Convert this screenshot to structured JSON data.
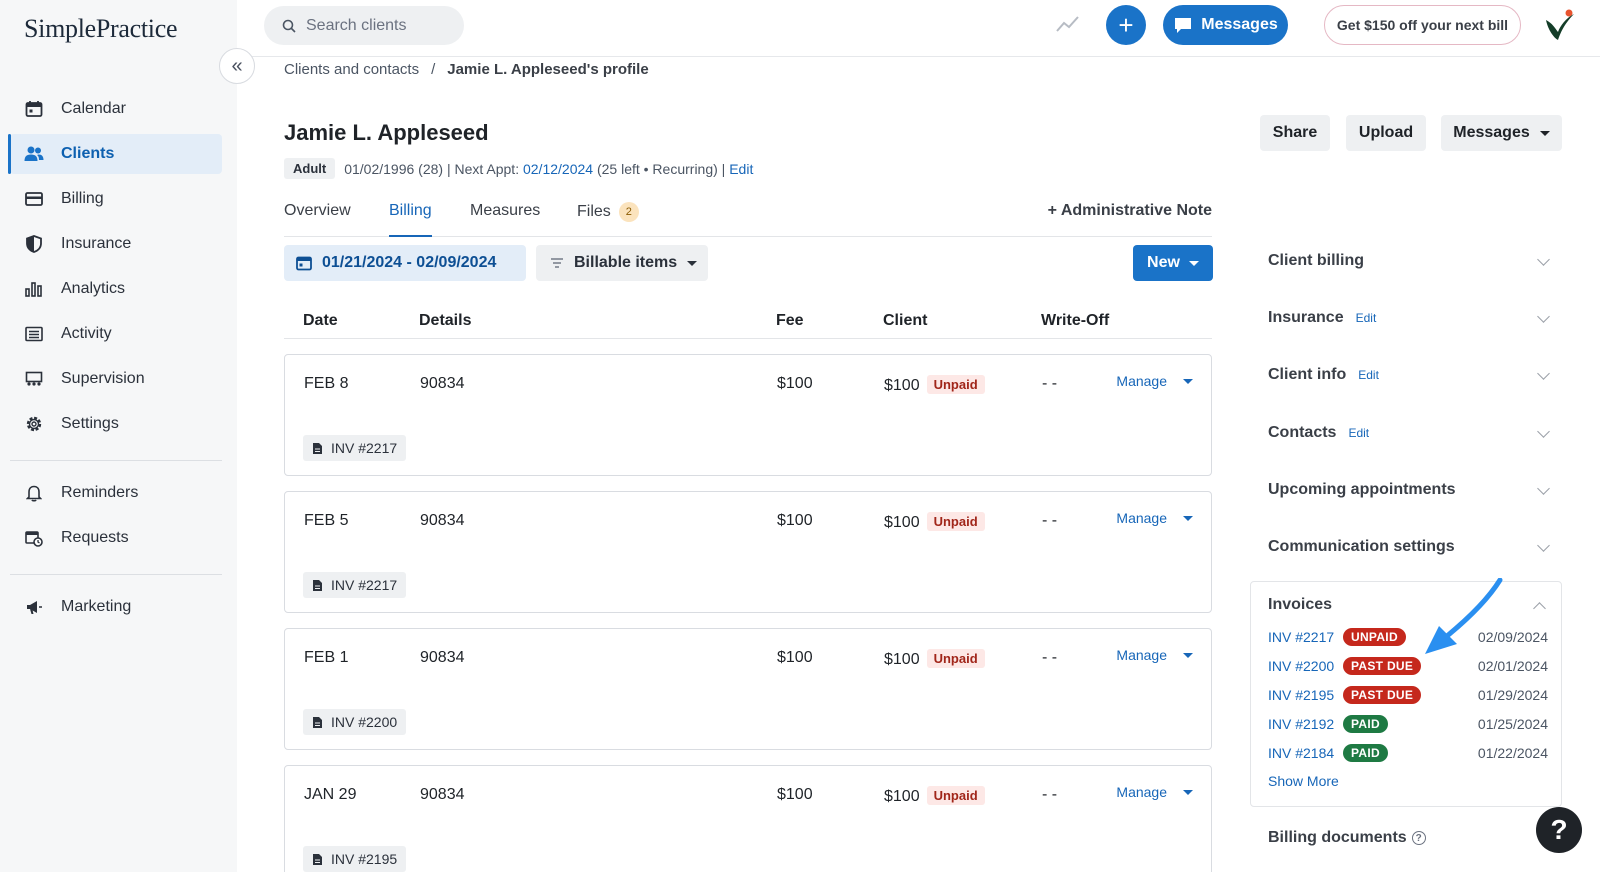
{
  "brand": {
    "logo_text": "SimplePractice"
  },
  "sidebar": {
    "items": [
      {
        "label": "Calendar",
        "icon": "calendar-icon"
      },
      {
        "label": "Clients",
        "icon": "users-icon",
        "active": true
      },
      {
        "label": "Billing",
        "icon": "credit-card-icon"
      },
      {
        "label": "Insurance",
        "icon": "shield-icon"
      },
      {
        "label": "Analytics",
        "icon": "bar-chart-icon"
      },
      {
        "label": "Activity",
        "icon": "list-icon"
      },
      {
        "label": "Supervision",
        "icon": "supervision-icon"
      },
      {
        "label": "Settings",
        "icon": "gear-icon"
      }
    ],
    "secondary": [
      {
        "label": "Reminders",
        "icon": "bell-icon"
      },
      {
        "label": "Requests",
        "icon": "calendar-clock-icon"
      }
    ],
    "tertiary": [
      {
        "label": "Marketing",
        "icon": "megaphone-icon"
      }
    ]
  },
  "topbar": {
    "search_placeholder": "Search clients",
    "messages_label": "Messages",
    "promo_label": "Get $150 off your next bill",
    "accent_color": "#1a73c8"
  },
  "breadcrumb": {
    "parent": "Clients and contacts",
    "separator": "/",
    "current": "Jamie L. Appleseed's profile"
  },
  "client": {
    "name": "Jamie L. Appleseed",
    "badge": "Adult",
    "dob": "01/02/1996 (28) | Next Appt:",
    "next_appt": "02/12/2024",
    "appt_detail": "(25 left • Recurring) |",
    "edit_label": "Edit"
  },
  "header_actions": {
    "share": "Share",
    "upload": "Upload",
    "messages": "Messages"
  },
  "tabs": {
    "overview": "Overview",
    "billing": "Billing",
    "measures": "Measures",
    "files": "Files",
    "files_count": "2",
    "admin_note": "+ Administrative Note"
  },
  "filters": {
    "date_range": "01/21/2024 - 02/09/2024",
    "billable": "Billable items",
    "new_label": "New"
  },
  "table": {
    "headers": {
      "date": "Date",
      "details": "Details",
      "fee": "Fee",
      "client": "Client",
      "writeoff": "Write-Off"
    },
    "rows": [
      {
        "date": "FEB 8",
        "details": "90834",
        "fee": "$100",
        "client": "$100",
        "status": "Unpaid",
        "writeoff": "- -",
        "manage": "Manage",
        "invoice": "INV #2217"
      },
      {
        "date": "FEB 5",
        "details": "90834",
        "fee": "$100",
        "client": "$100",
        "status": "Unpaid",
        "writeoff": "- -",
        "manage": "Manage",
        "invoice": "INV #2217"
      },
      {
        "date": "FEB 1",
        "details": "90834",
        "fee": "$100",
        "client": "$100",
        "status": "Unpaid",
        "writeoff": "- -",
        "manage": "Manage",
        "invoice": "INV #2200"
      },
      {
        "date": "JAN 29",
        "details": "90834",
        "fee": "$100",
        "client": "$100",
        "status": "Unpaid",
        "writeoff": "- -",
        "manage": "Manage",
        "invoice": "INV #2195"
      }
    ]
  },
  "right_panel": {
    "sections": [
      {
        "label": "Client billing",
        "edit": ""
      },
      {
        "label": "Insurance",
        "edit": "Edit"
      },
      {
        "label": "Client info",
        "edit": "Edit"
      },
      {
        "label": "Contacts",
        "edit": "Edit"
      },
      {
        "label": "Upcoming appointments",
        "edit": ""
      },
      {
        "label": "Communication settings",
        "edit": ""
      }
    ],
    "invoices": {
      "title": "Invoices",
      "rows": [
        {
          "number": "INV #2217",
          "status": "UNPAID",
          "status_color": "#c5281c",
          "date": "02/09/2024"
        },
        {
          "number": "INV #2200",
          "status": "PAST DUE",
          "status_color": "#c5281c",
          "date": "02/01/2024"
        },
        {
          "number": "INV #2195",
          "status": "PAST DUE",
          "status_color": "#c5281c",
          "date": "01/29/2024"
        },
        {
          "number": "INV #2192",
          "status": "PAID",
          "status_color": "#1e7a43",
          "date": "01/25/2024"
        },
        {
          "number": "INV #2184",
          "status": "PAID",
          "status_color": "#1e7a43",
          "date": "01/22/2024"
        }
      ],
      "show_more": "Show More"
    },
    "billing_documents": "Billing documents"
  },
  "help_label": "?"
}
